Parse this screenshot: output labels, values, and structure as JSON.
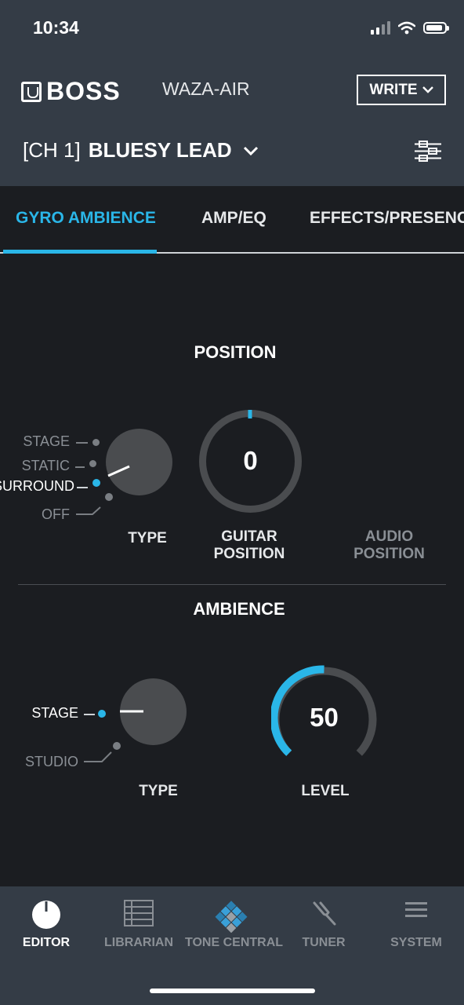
{
  "status_bar": {
    "time": "10:34"
  },
  "header": {
    "brand": "BOSS",
    "model": "WAZA-AIR",
    "write_label": "WRITE",
    "patch_channel": "[CH 1]",
    "patch_name": "BLUESY LEAD"
  },
  "tabs": [
    {
      "label": "GYRO AMBIENCE",
      "active": true
    },
    {
      "label": "AMP/EQ",
      "active": false
    },
    {
      "label": "EFFECTS/PRESENCE",
      "active": false
    }
  ],
  "position": {
    "title": "POSITION",
    "type_label": "TYPE",
    "type_options": [
      "STAGE",
      "STATIC",
      "SURROUND",
      "OFF"
    ],
    "type_selected": "SURROUND",
    "guitar_position_label_1": "GUITAR",
    "guitar_position_label_2": "POSITION",
    "guitar_position_value": "0",
    "audio_position_label_1": "AUDIO",
    "audio_position_label_2": "POSITION"
  },
  "ambience": {
    "title": "AMBIENCE",
    "type_label": "TYPE",
    "type_options": [
      "STAGE",
      "STUDIO"
    ],
    "type_selected": "STAGE",
    "level_label": "LEVEL",
    "level_value": "50"
  },
  "bottom_nav": [
    {
      "label": "EDITOR",
      "icon": "editor-knob-icon",
      "active": true
    },
    {
      "label": "LIBRARIAN",
      "icon": "librarian-list-icon",
      "active": false
    },
    {
      "label": "TONE CENTRAL",
      "icon": "tone-central-icon",
      "active": false
    },
    {
      "label": "TUNER",
      "icon": "tuner-fork-icon",
      "active": false
    },
    {
      "label": "SYSTEM",
      "icon": "menu-icon",
      "active": false
    }
  ],
  "colors": {
    "accent": "#2ab6e8",
    "header_bg": "#343c46",
    "body_bg": "#1b1d21"
  }
}
